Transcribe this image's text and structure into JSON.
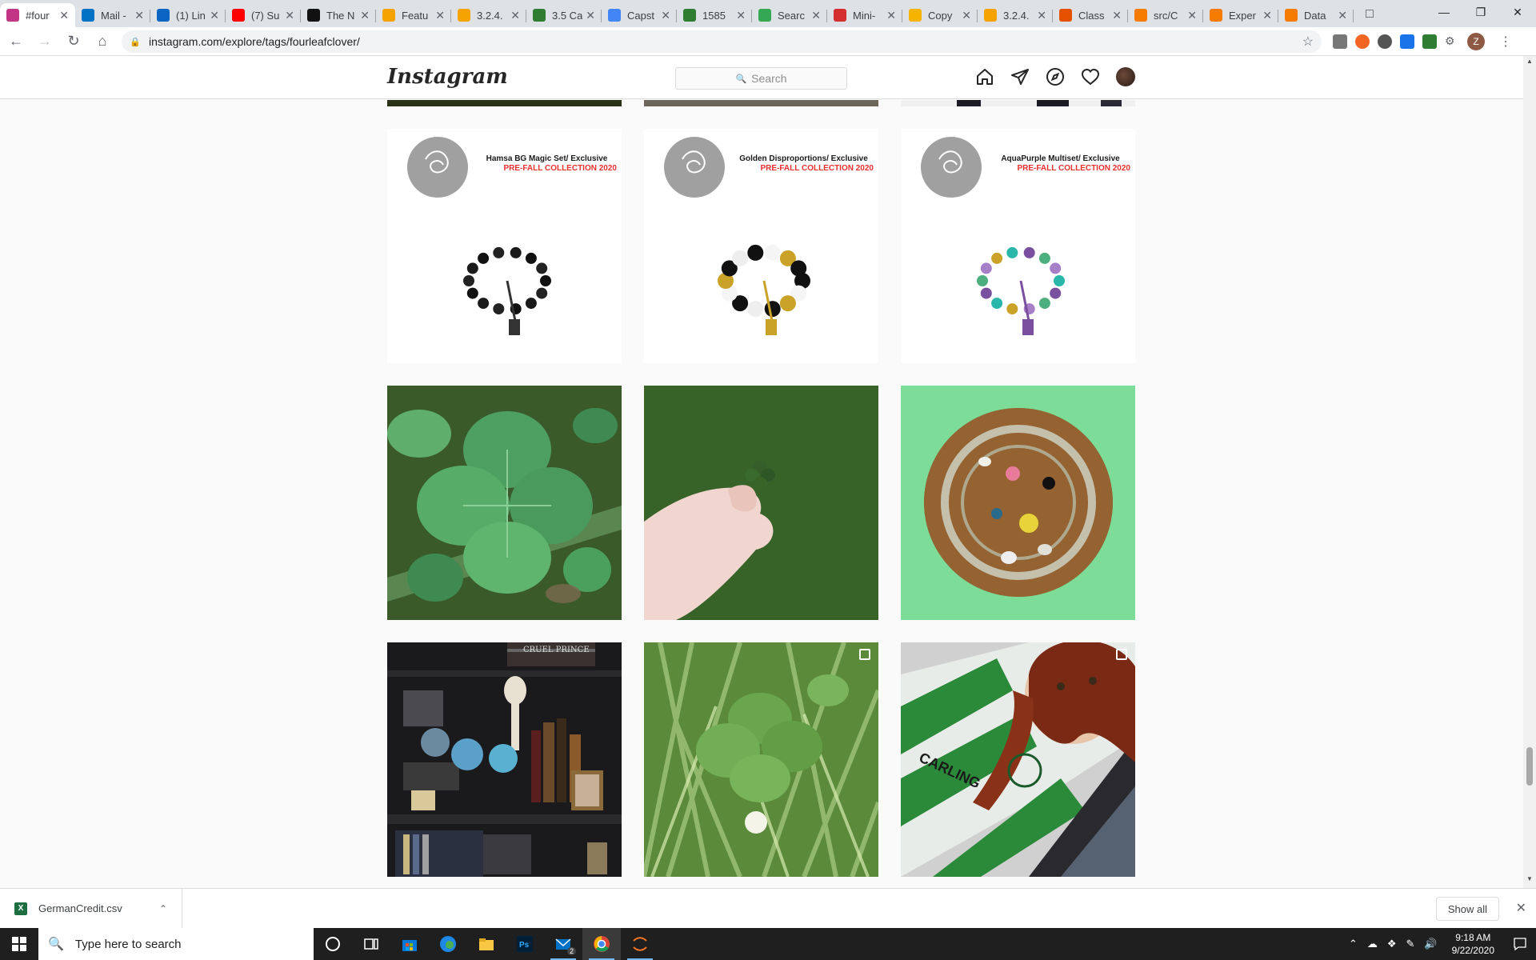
{
  "browser": {
    "tabs": [
      {
        "label": "#four",
        "color": "#c13584",
        "active": true
      },
      {
        "label": "Mail -",
        "color": "#0072c6"
      },
      {
        "label": "(1) Lin",
        "color": "#0a66c2"
      },
      {
        "label": "(7) Su",
        "color": "#ff0000"
      },
      {
        "label": "The N",
        "color": "#111111"
      },
      {
        "label": "Featu",
        "color": "#f4a300"
      },
      {
        "label": "3.2.4.",
        "color": "#f4a300"
      },
      {
        "label": "3.5 Ca",
        "color": "#2e7d32"
      },
      {
        "label": "Capst",
        "color": "#4285f4"
      },
      {
        "label": "1585",
        "color": "#2e7d32"
      },
      {
        "label": "Searc",
        "color": "#34a853"
      },
      {
        "label": "Mini-",
        "color": "#d32f2f"
      },
      {
        "label": "Copy",
        "color": "#f4b400"
      },
      {
        "label": "3.2.4.",
        "color": "#f4a300"
      },
      {
        "label": "Class",
        "color": "#e65100"
      },
      {
        "label": "src/C",
        "color": "#f57c00"
      },
      {
        "label": "Exper",
        "color": "#f57c00"
      },
      {
        "label": "Data",
        "color": "#f57c00"
      }
    ],
    "url": "instagram.com/explore/tags/fourleafclover/",
    "profile_initial": "Z"
  },
  "instagram": {
    "logo": "Instagram",
    "search_placeholder": "Search",
    "posts": [
      {
        "kind": "jewelry",
        "title": "Hamsa BG Magic Set/ Exclusive",
        "subtitle": "PRE-FALL COLLECTION 2020",
        "variant": "black"
      },
      {
        "kind": "jewelry",
        "title": "Golden Disproportions/ Exclusive",
        "subtitle": "PRE-FALL COLLECTION 2020",
        "variant": "gold"
      },
      {
        "kind": "jewelry",
        "title": "AquaPurple Multiset/ Exclusive",
        "subtitle": "PRE-FALL COLLECTION 2020",
        "variant": "aqua"
      },
      {
        "kind": "clover"
      },
      {
        "kind": "hand-clover"
      },
      {
        "kind": "dish"
      },
      {
        "kind": "shelf",
        "book_text": "CRUEL PRINCE"
      },
      {
        "kind": "clover2",
        "multi": true
      },
      {
        "kind": "selfie",
        "multi": true,
        "shirt_text": "CARLING"
      }
    ]
  },
  "downloads": {
    "filename": "GermanCredit.csv",
    "show_all": "Show all"
  },
  "taskbar": {
    "search_placeholder": "Type here to search",
    "time": "9:18 AM",
    "date": "9/22/2020",
    "mail_badge": "2"
  }
}
